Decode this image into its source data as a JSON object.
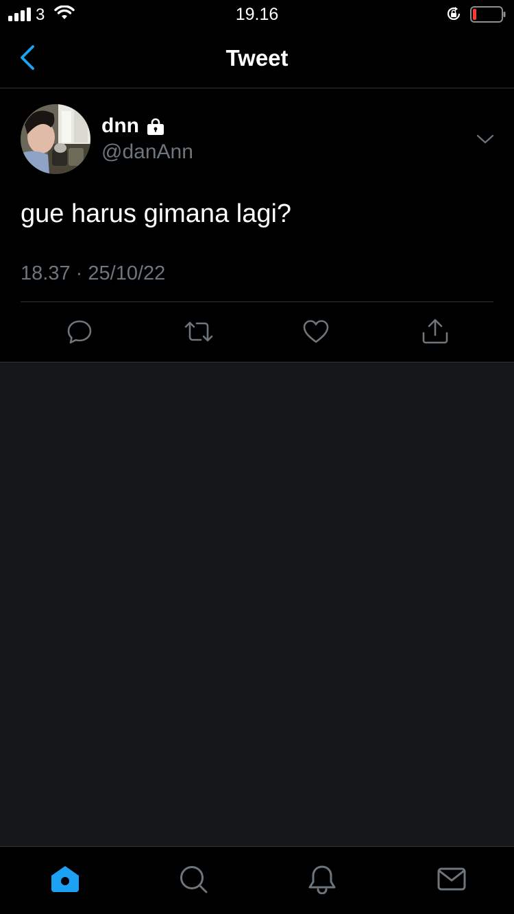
{
  "status_bar": {
    "carrier": "3",
    "time": "19.16",
    "battery_level": 0.12,
    "battery_color": "#ff3b30"
  },
  "header": {
    "title": "Tweet",
    "accent_color": "#1da1f2"
  },
  "tweet": {
    "display_name": "dnn",
    "handle": "@danAnn",
    "protected": true,
    "text": "gue harus gimana lagi?",
    "time": "18.37",
    "separator": "·",
    "date": "25/10/22",
    "actions": [
      "reply-icon",
      "retweet-icon",
      "like-icon",
      "share-icon"
    ]
  },
  "tab_bar": {
    "items": [
      "home-icon",
      "search-icon",
      "notifications-icon",
      "messages-icon"
    ],
    "active": "home-icon",
    "active_color": "#1da1f2",
    "inactive_color": "#6e767d"
  }
}
